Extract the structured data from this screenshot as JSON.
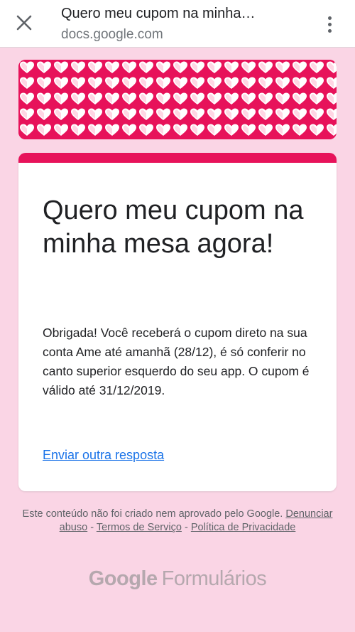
{
  "browser": {
    "tab_title": "Quero meu cupom na minha…",
    "url": "docs.google.com",
    "icons": {
      "close": "close-icon",
      "menu": "more-vert-icon"
    }
  },
  "theme": {
    "accent": "#e7125a",
    "background": "#fad5e5",
    "link": "#1a73e8"
  },
  "form": {
    "title": "Quero meu cupom na minha mesa agora!",
    "confirmation_message": "Obrigada! Você receberá o cupom direto na sua conta Ame até amanhã (28/12), é só conferir no canto superior esquerdo do seu app. O cupom é válido até 31/12/2019.",
    "resubmit_link": "Enviar outra resposta"
  },
  "footer": {
    "disclaimer": "Este conteúdo não foi criado nem aprovado pelo Google.",
    "report_abuse": "Denunciar abuso",
    "separator": "-",
    "terms": "Termos de Serviço",
    "privacy": "Política de Privacidade",
    "logo_google": "Google",
    "logo_product": "Formulários"
  }
}
